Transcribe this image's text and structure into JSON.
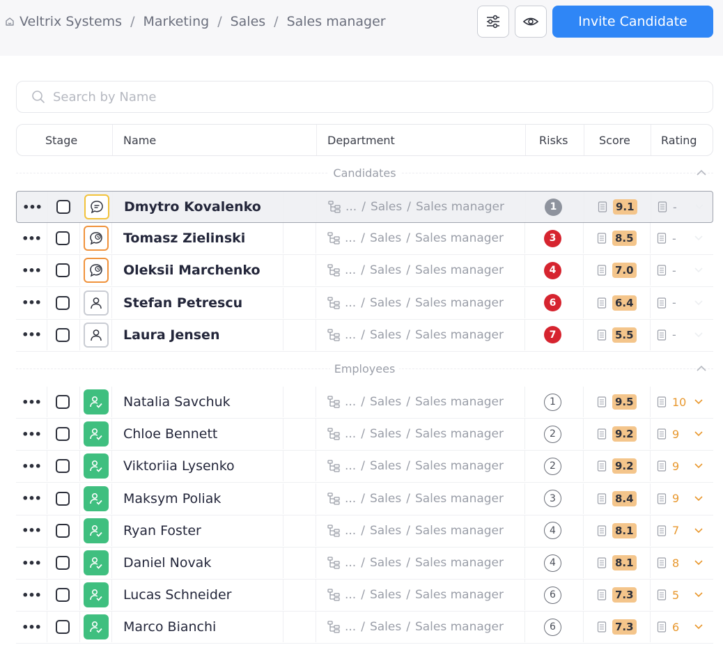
{
  "breadcrumb": [
    "Veltrix Systems",
    "Marketing",
    "Sales",
    "Sales manager"
  ],
  "header_actions": {
    "filter_icon": "sliders-icon",
    "view_icon": "eye-icon",
    "invite_label": "Invite Candidate"
  },
  "search": {
    "placeholder": "Search by Name",
    "icon": "search-icon"
  },
  "columns": {
    "stage": "Stage",
    "name": "Name",
    "department": "Department",
    "risks": "Risks",
    "score": "Score",
    "rating": "Rating"
  },
  "candidates": {
    "label": "Candidates",
    "rows": [
      {
        "name": "Dmytro Kovalenko",
        "stage_icon": "chat-bubble-icon",
        "stage_color": "#f2c23a",
        "dept_prefix": "...",
        "dept_path": [
          "Sales",
          "Sales manager"
        ],
        "risk": "1",
        "risk_style": "grey",
        "score": "9.1",
        "rating": "-"
      },
      {
        "name": "Tomasz Zielinski",
        "stage_icon": "clock-chat-icon",
        "stage_color": "#f0923b",
        "dept_prefix": "...",
        "dept_path": [
          "Sales",
          "Sales manager"
        ],
        "risk": "3",
        "risk_style": "red",
        "score": "8.5",
        "rating": "-"
      },
      {
        "name": "Oleksii Marchenko",
        "stage_icon": "clock-chat-icon",
        "stage_color": "#f0923b",
        "dept_prefix": "...",
        "dept_path": [
          "Sales",
          "Sales manager"
        ],
        "risk": "4",
        "risk_style": "red",
        "score": "7.0",
        "rating": "-"
      },
      {
        "name": "Stefan Petrescu",
        "stage_icon": "person-icon",
        "stage_color": "#c9ccd3",
        "dept_prefix": "...",
        "dept_path": [
          "Sales",
          "Sales manager"
        ],
        "risk": "6",
        "risk_style": "red",
        "score": "6.4",
        "rating": "-"
      },
      {
        "name": "Laura Jensen",
        "stage_icon": "person-icon",
        "stage_color": "#c9ccd3",
        "dept_prefix": "...",
        "dept_path": [
          "Sales",
          "Sales manager"
        ],
        "risk": "7",
        "risk_style": "red",
        "score": "5.5",
        "rating": "-"
      }
    ]
  },
  "employees": {
    "label": "Employees",
    "rows": [
      {
        "name": "Natalia Savchuk",
        "stage_icon": "employee-icon",
        "stage_color": "#3fbf7f",
        "dept_prefix": "...",
        "dept_path": [
          "Sales",
          "Sales manager"
        ],
        "risk": "1",
        "risk_style": "outline",
        "score": "9.5",
        "rating": "10"
      },
      {
        "name": "Chloe Bennett",
        "stage_icon": "employee-icon",
        "stage_color": "#3fbf7f",
        "dept_prefix": "...",
        "dept_path": [
          "Sales",
          "Sales manager"
        ],
        "risk": "2",
        "risk_style": "outline",
        "score": "9.2",
        "rating": "9"
      },
      {
        "name": "Viktoriia Lysenko",
        "stage_icon": "employee-icon",
        "stage_color": "#3fbf7f",
        "dept_prefix": "...",
        "dept_path": [
          "Sales",
          "Sales manager"
        ],
        "risk": "2",
        "risk_style": "outline",
        "score": "9.2",
        "rating": "9"
      },
      {
        "name": "Maksym Poliak",
        "stage_icon": "employee-icon",
        "stage_color": "#3fbf7f",
        "dept_prefix": "...",
        "dept_path": [
          "Sales",
          "Sales manager"
        ],
        "risk": "3",
        "risk_style": "outline",
        "score": "8.4",
        "rating": "9"
      },
      {
        "name": "Ryan Foster",
        "stage_icon": "employee-icon",
        "stage_color": "#3fbf7f",
        "dept_prefix": "...",
        "dept_path": [
          "Sales",
          "Sales manager"
        ],
        "risk": "4",
        "risk_style": "outline",
        "score": "8.1",
        "rating": "7"
      },
      {
        "name": "Daniel Novak",
        "stage_icon": "employee-icon",
        "stage_color": "#3fbf7f",
        "dept_prefix": "...",
        "dept_path": [
          "Sales",
          "Sales manager"
        ],
        "risk": "4",
        "risk_style": "outline",
        "score": "8.1",
        "rating": "8"
      },
      {
        "name": "Lucas Schneider",
        "stage_icon": "employee-icon",
        "stage_color": "#3fbf7f",
        "dept_prefix": "...",
        "dept_path": [
          "Sales",
          "Sales manager"
        ],
        "risk": "6",
        "risk_style": "outline",
        "score": "7.3",
        "rating": "5"
      },
      {
        "name": "Marco Bianchi",
        "stage_icon": "employee-icon",
        "stage_color": "#3fbf7f",
        "dept_prefix": "...",
        "dept_path": [
          "Sales",
          "Sales manager"
        ],
        "risk": "6",
        "risk_style": "outline",
        "score": "7.3",
        "rating": "6"
      }
    ]
  },
  "colors": {
    "accent": "#2f86f6",
    "score_badge": "#f4c58b",
    "risk_red": "#d6242f",
    "employee_green": "#3fbf7f",
    "rating_orange": "#e8972c"
  }
}
